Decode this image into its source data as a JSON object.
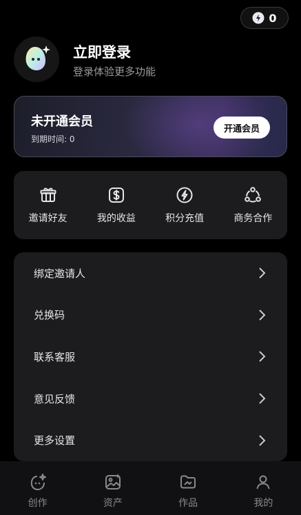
{
  "header": {
    "points": "0",
    "points_icon": "bolt-coin-icon"
  },
  "profile": {
    "title": "立即登录",
    "subtitle": "登录体验更多功能",
    "avatar_icon": "sprite-avatar-icon"
  },
  "vip": {
    "title": "未开通会员",
    "expire": "到期时间: 0",
    "button": "开通会员"
  },
  "actions": [
    {
      "label": "邀请好友",
      "icon": "gift-icon"
    },
    {
      "label": "我的收益",
      "icon": "dollar-icon"
    },
    {
      "label": "积分充值",
      "icon": "bolt-icon"
    },
    {
      "label": "商务合作",
      "icon": "network-icon"
    }
  ],
  "menu": [
    {
      "label": "绑定邀请人"
    },
    {
      "label": "兑换码"
    },
    {
      "label": "联系客服"
    },
    {
      "label": "意见反馈"
    },
    {
      "label": "更多设置"
    }
  ],
  "tabs": [
    {
      "label": "创作",
      "icon": "create-icon"
    },
    {
      "label": "资产",
      "icon": "assets-icon"
    },
    {
      "label": "作品",
      "icon": "works-icon"
    },
    {
      "label": "我的",
      "icon": "profile-icon"
    }
  ],
  "colors": {
    "background": "#000000",
    "card": "#1c1c1e",
    "accent_vip": "#3a2e58"
  }
}
